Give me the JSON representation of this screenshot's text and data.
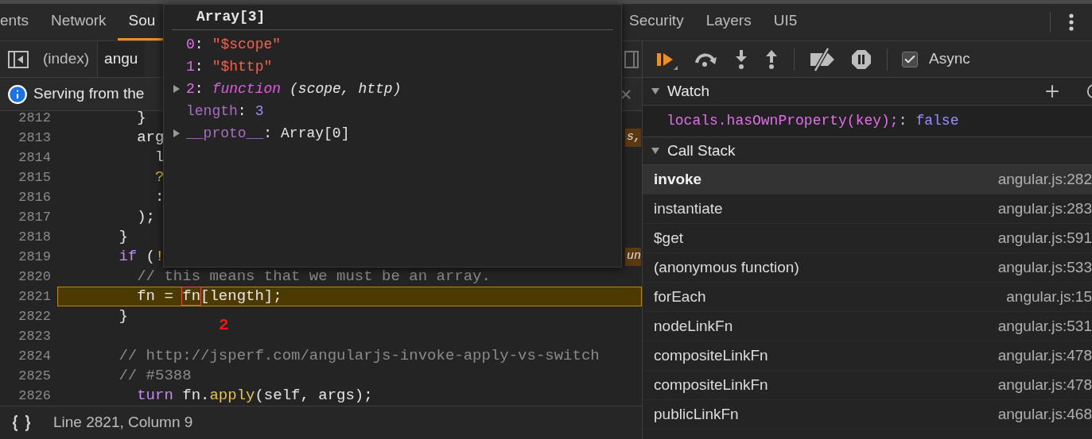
{
  "tabs": [
    {
      "label": "ents",
      "selected": false
    },
    {
      "label": "Network",
      "selected": false
    },
    {
      "label": "Sou",
      "selected": true
    },
    {
      "label": "Security",
      "selected": false
    },
    {
      "label": "Layers",
      "selected": false
    },
    {
      "label": "UI5",
      "selected": false
    }
  ],
  "file_tabs": [
    {
      "label": "(index)",
      "selected": false
    },
    {
      "label": "angu",
      "selected": true
    }
  ],
  "info_bar": {
    "text": "Serving from the"
  },
  "code": {
    "lines": [
      {
        "number": "2812",
        "current": false,
        "tokens": [
          {
            "text": "        }",
            "kind": "plain"
          }
        ]
      },
      {
        "number": "2813",
        "current": false,
        "tokens": [
          {
            "text": "        arg",
            "kind": "plain"
          }
        ],
        "edge": "s,"
      },
      {
        "number": "2814",
        "current": false,
        "tokens": [
          {
            "text": "          l",
            "kind": "plain"
          }
        ]
      },
      {
        "number": "2815",
        "current": false,
        "tokens": [
          {
            "text": "          ?",
            "kind": "yellow"
          }
        ]
      },
      {
        "number": "2816",
        "current": false,
        "tokens": [
          {
            "text": "          :",
            "kind": "plain"
          }
        ]
      },
      {
        "number": "2817",
        "current": false,
        "tokens": [
          {
            "text": "        );",
            "kind": "plain"
          }
        ]
      },
      {
        "number": "2818",
        "current": false,
        "tokens": [
          {
            "text": "      }",
            "kind": "plain"
          }
        ]
      },
      {
        "number": "2819",
        "current": false,
        "tokens": [
          {
            "text": "      if",
            "kind": "keyword"
          },
          {
            "text": " (",
            "kind": "plain"
          },
          {
            "text": "!",
            "kind": "yellow"
          }
        ],
        "edge": "un"
      },
      {
        "number": "2820",
        "current": false,
        "tokens": [
          {
            "text": "        // this means that we must be an array.",
            "kind": "comment"
          }
        ]
      },
      {
        "number": "2821",
        "current": true,
        "tokens": [
          {
            "text": "        fn = ",
            "kind": "plain"
          },
          {
            "text": "fn",
            "kind": "hovered"
          },
          {
            "text": "[length];",
            "kind": "plain"
          }
        ]
      },
      {
        "number": "2822",
        "current": false,
        "tokens": [
          {
            "text": "      }",
            "kind": "plain"
          }
        ]
      },
      {
        "number": "2823",
        "current": false
      },
      {
        "number": "2824",
        "current": false,
        "tokens": [
          {
            "text": "      // http://jsperf.com/angularjs-invoke-apply-vs-switch",
            "kind": "comment"
          }
        ]
      },
      {
        "number": "2825",
        "current": false,
        "tokens": [
          {
            "text": "      // #5388",
            "kind": "comment"
          }
        ]
      },
      {
        "number": "2826",
        "current": false,
        "tokens": [
          {
            "text": "        turn",
            "kind": "keyword"
          },
          {
            "text": " fn.",
            "kind": "plain"
          },
          {
            "text": "apply",
            "kind": "yellow"
          },
          {
            "text": "(self, args);",
            "kind": "plain"
          }
        ]
      }
    ]
  },
  "annotation": "2",
  "popover": {
    "title": "Array[3]",
    "entries": [
      {
        "key": "0",
        "separator": ":",
        "value": "\"$scope\"",
        "kind": "string",
        "expandable": false,
        "dimmed": false
      },
      {
        "key": "1",
        "separator": ":",
        "value": "\"$http\"",
        "kind": "string",
        "expandable": false,
        "dimmed": false
      },
      {
        "key": "2",
        "separator": ":",
        "value": "function",
        "rest": "(scope, http)",
        "kind": "function",
        "expandable": true,
        "dimmed": false
      },
      {
        "key": "length",
        "separator": ":",
        "value": "3",
        "kind": "number",
        "expandable": false,
        "dimmed": true
      },
      {
        "key": "__proto__",
        "separator": ":",
        "value": "Array[0]",
        "kind": "object",
        "expandable": true,
        "dimmed": true
      }
    ]
  },
  "status_bar": {
    "position": "Line 2821, Column 9"
  },
  "debugger": {
    "async": {
      "label": "Async",
      "checked": true
    }
  },
  "watch": {
    "title": "Watch",
    "expanded": true,
    "expressions": [
      {
        "expression": "locals.hasOwnProperty(key);",
        "separator": ":",
        "value": "false"
      }
    ]
  },
  "call_stack": {
    "title": "Call Stack",
    "expanded": true,
    "frames": [
      {
        "name": "invoke",
        "location": "angular.js:282",
        "selected": true
      },
      {
        "name": "instantiate",
        "location": "angular.js:283",
        "selected": false
      },
      {
        "name": "$get",
        "location": "angular.js:591",
        "selected": false
      },
      {
        "name": "(anonymous function)",
        "location": "angular.js:533",
        "selected": false
      },
      {
        "name": "forEach",
        "location": "angular.js:15",
        "selected": false
      },
      {
        "name": "nodeLinkFn",
        "location": "angular.js:531",
        "selected": false
      },
      {
        "name": "compositeLinkFn",
        "location": "angular.js:478",
        "selected": false
      },
      {
        "name": "compositeLinkFn",
        "location": "angular.js:478",
        "selected": false
      },
      {
        "name": "publicLinkFn",
        "location": "angular.js:468",
        "selected": false
      }
    ]
  }
}
